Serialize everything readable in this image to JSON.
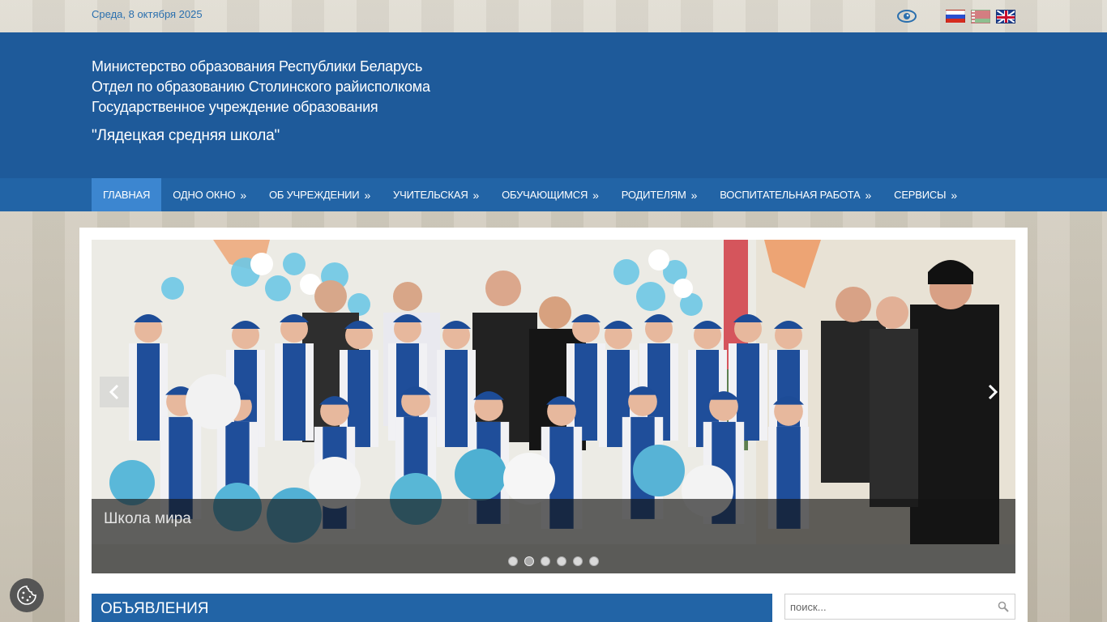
{
  "topbar": {
    "date": "Среда, 8 октября 2025",
    "accessibility_icon": "eye-icon",
    "languages": [
      "ru",
      "by",
      "en"
    ]
  },
  "header": {
    "line1": "Министерство образования Республики Беларусь",
    "line2": "Отдел по образованию Столинского райисполкома",
    "line3": "Государственное учреждение образования",
    "line4": "\"Лядецкая средняя школа\""
  },
  "nav": {
    "items": [
      {
        "label": "Главная",
        "has_submenu": false,
        "active": true
      },
      {
        "label": "Одно окно",
        "has_submenu": true
      },
      {
        "label": "Об учреждении",
        "has_submenu": true
      },
      {
        "label": "Учительская",
        "has_submenu": true
      },
      {
        "label": "Обучающимся",
        "has_submenu": true
      },
      {
        "label": "Родителям",
        "has_submenu": true
      },
      {
        "label": "Воспитательная работа",
        "has_submenu": true
      },
      {
        "label": "Сервисы",
        "has_submenu": true
      }
    ],
    "submenu_arrow": "»"
  },
  "slider": {
    "caption": "Школа мира",
    "slide_count": 6,
    "active_slide": 2,
    "prev_icon": "chevron-left-icon",
    "next_icon": "chevron-right-icon"
  },
  "sections": {
    "announcements_title": "Объявления"
  },
  "search": {
    "placeholder": "поиск..."
  },
  "colors": {
    "header_blue": "#1e5a9a",
    "nav_blue": "#2264a6",
    "nav_active": "#3c86d0",
    "date_text": "#2a6fae"
  }
}
